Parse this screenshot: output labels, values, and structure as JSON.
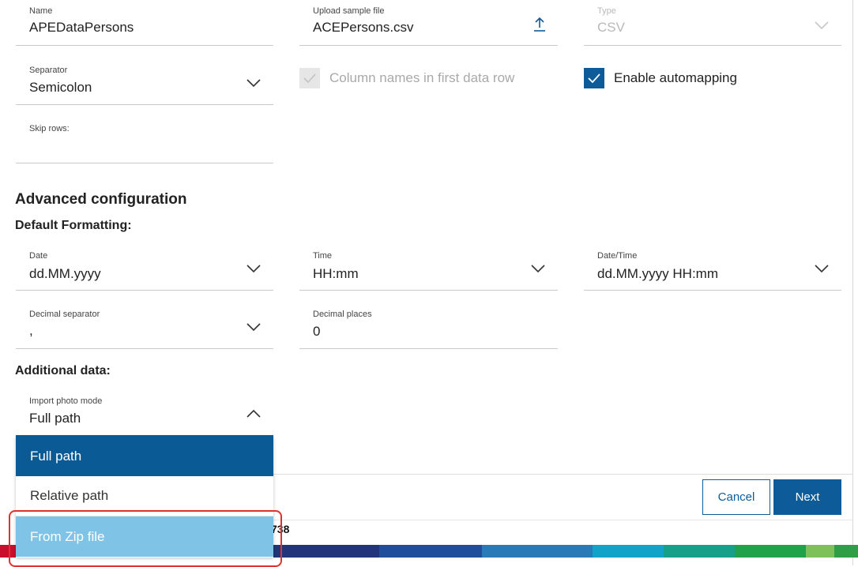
{
  "fields": {
    "name": {
      "label": "Name",
      "value": "APEDataPersons"
    },
    "upload": {
      "label": "Upload sample file",
      "value": "ACEPersons.csv",
      "icon": "upload-icon"
    },
    "type": {
      "label": "Type",
      "value": "CSV"
    },
    "separator": {
      "label": "Separator",
      "value": "Semicolon"
    },
    "skip_rows": {
      "label": "Skip rows:",
      "value": ""
    }
  },
  "checkboxes": {
    "column_names": {
      "label": "Column names in first data row",
      "checked": true,
      "disabled": true
    },
    "automapping": {
      "label": "Enable automapping",
      "checked": true,
      "disabled": false
    }
  },
  "advanced": {
    "title": "Advanced configuration",
    "default_formatting": "Default Formatting:",
    "date": {
      "label": "Date",
      "value": "dd.MM.yyyy"
    },
    "time": {
      "label": "Time",
      "value": "HH:mm"
    },
    "datetime": {
      "label": "Date/Time",
      "value": "dd.MM.yyyy HH:mm"
    },
    "decimal_separator": {
      "label": "Decimal separator",
      "value": ","
    },
    "decimal_places": {
      "label": "Decimal places",
      "value": "0"
    }
  },
  "additional": {
    "title": "Additional data:",
    "import_photo_mode": {
      "label": "Import photo mode",
      "value": "Full path"
    },
    "options": [
      "Full path",
      "Relative path",
      "From Zip file"
    ]
  },
  "footer": {
    "cancel_label": "Cancel",
    "next_label": "Next",
    "version_fragment": "738"
  },
  "colors": {
    "accent": "#0d5c99",
    "hover": "#7fc4e6",
    "highlight": "#e03131"
  }
}
